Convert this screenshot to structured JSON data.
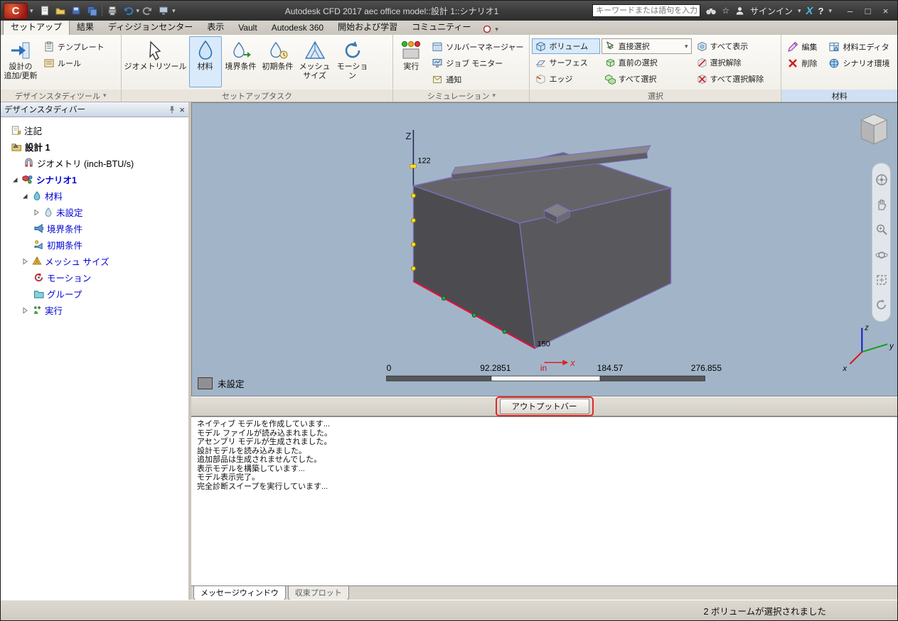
{
  "glyphs": {
    "caret_down": "▾",
    "minimize": "–",
    "maximize": "□",
    "close": "×",
    "star": "☆",
    "help": "?",
    "a360": "X",
    "app_initial": "C"
  },
  "titlebar": {
    "title": "Autodesk CFD 2017   aec office model::設計 1::シナリオ1",
    "search_placeholder": "キーワードまたは語句を入力",
    "signin": "サインイン"
  },
  "menu": {
    "tabs": [
      "セットアップ",
      "結果",
      "ディシジョンセンター",
      "表示",
      "Vault",
      "Autodesk 360",
      "開始および学習",
      "コミュニティー"
    ]
  },
  "ribbon": {
    "design_study": {
      "title": "デザインスタディツール",
      "add_update": "設計の\n追加/更新",
      "template": "テンプレート",
      "rules": "ルール"
    },
    "setup_tasks": {
      "title": "セットアップタスク",
      "geometry_tools": "ジオメトリツール",
      "material": "材料",
      "boundary": "境界条件",
      "initial": "初期条件",
      "mesh_size": "メッシュ\nサイズ",
      "motion": "モーション"
    },
    "simulation": {
      "title": "シミュレーション",
      "run": "実行",
      "solver_manager": "ソルバーマネージャー",
      "job_monitor": "ジョブ モニター",
      "notification": "通知"
    },
    "selection": {
      "title": "選択",
      "volume": "ボリューム",
      "surface": "サーフェス",
      "edge": "エッジ",
      "direct": "直接選択",
      "previous": "直前の選択",
      "select_all": "すべて選択",
      "show_all": "すべて表示",
      "deselect": "選択解除",
      "deselect_all": "すべて選択解除"
    },
    "material_panel": {
      "title": "材料",
      "edit": "編集",
      "delete": "削除",
      "material_editor": "材料エディタ",
      "scenario_env": "シナリオ環境"
    }
  },
  "design_study_bar": {
    "title": "デザインスタディバー",
    "items": {
      "notes": "注記",
      "design": "設計 1",
      "geometry": "ジオメトリ (inch-BTU/s)",
      "scenario": "シナリオ1",
      "material": "材料",
      "not_set": "未設定",
      "boundary": "境界条件",
      "initial": "初期条件",
      "mesh_size": "メッシュ サイズ",
      "motion": "モーション",
      "group": "グループ",
      "run": "実行"
    }
  },
  "viewport": {
    "z_axis": "Z",
    "dim_z": "122",
    "dim_x": "150",
    "x_axis": "x",
    "ruler": {
      "start": "0",
      "q1": "92.2851",
      "unit": "in",
      "mid": "184.57",
      "end": "276.855"
    },
    "legend": "未設定",
    "triad": {
      "x": "x",
      "y": "y",
      "z": "z"
    }
  },
  "output_bar": {
    "label": "アウトプットバー"
  },
  "messages": [
    "ネイティブ モデルを作成しています...",
    "モデル ファイルが読み込まれました。",
    "アセンブリ モデルが生成されました。",
    "設計モデルを読み込みました。",
    "追加部品は生成されませんでした。",
    "表示モデルを構築しています...",
    "モデル表示完了。",
    "完全診断スイープを実行しています..."
  ],
  "bottom_tabs": {
    "message_window": "メッセージウィンドウ",
    "convergence_plot": "収束プロット"
  },
  "status_bar": {
    "text": "2 ボリュームが選択されました"
  }
}
